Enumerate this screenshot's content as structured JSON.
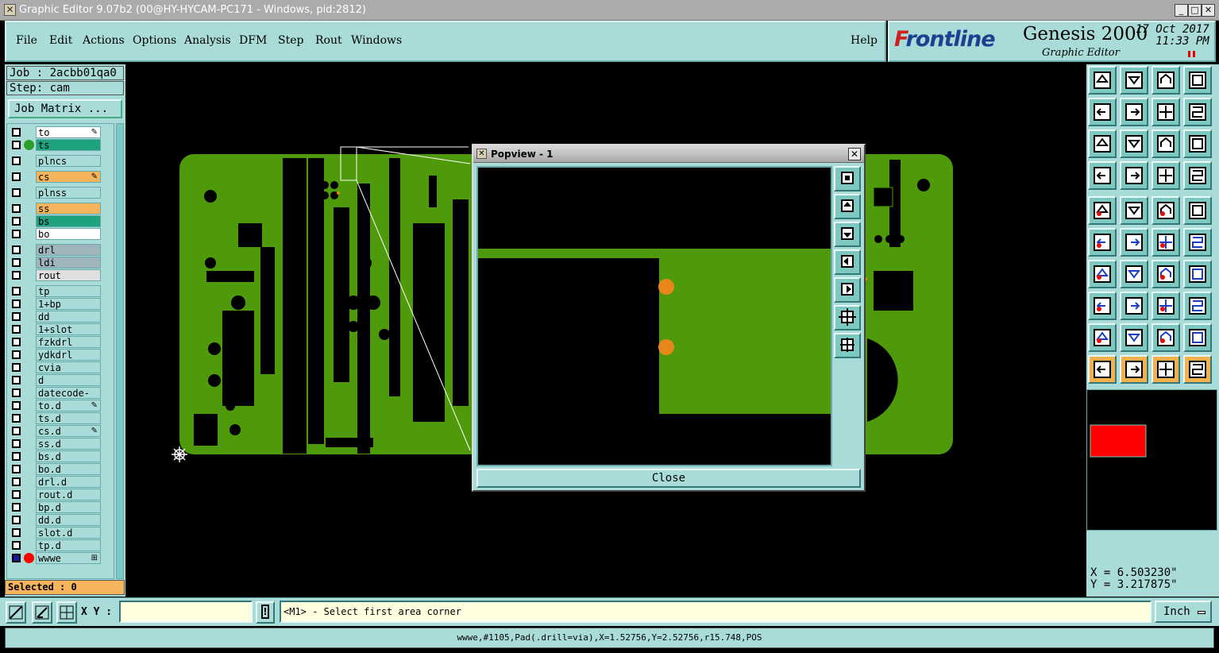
{
  "window": {
    "title": "Graphic Editor 9.07b2 (00@HY-HYCAM-PC171 - Windows, pid:2812)"
  },
  "menu": {
    "items": [
      "File",
      "Edit",
      "Actions",
      "Options",
      "Analysis",
      "DFM",
      "Step",
      "Rout",
      "Windows"
    ],
    "help": "Help"
  },
  "brand": {
    "logo_f": "F",
    "logo_rest": "rontline",
    "product": "Genesis 2000",
    "subtitle": "Graphic Editor",
    "date": "17 Oct 2017",
    "time": "11:33 PM"
  },
  "job": {
    "job_label": "Job : 2acbb01qa0",
    "step_label": "Step: cam",
    "matrix_button": "Job Matrix ..."
  },
  "layers": [
    {
      "name": "to",
      "color": "#ffffff",
      "dot": "",
      "edit": "✎"
    },
    {
      "name": "ts",
      "color": "#1fa37e",
      "dot": "#2aa02a",
      "edit": ""
    },
    {
      "name": "plncs",
      "color": "#a9dcd8",
      "dot": "",
      "edit": ""
    },
    {
      "name": "cs",
      "color": "#f6b55c",
      "dot": "",
      "edit": "✎"
    },
    {
      "name": "plnss",
      "color": "#a9dcd8",
      "dot": "",
      "edit": ""
    },
    {
      "name": "ss",
      "color": "#f6b55c",
      "dot": "",
      "edit": ""
    },
    {
      "name": "bs",
      "color": "#1fa37e",
      "dot": "",
      "edit": ""
    },
    {
      "name": "bo",
      "color": "#ffffff",
      "dot": "",
      "edit": ""
    },
    {
      "name": "drl",
      "color": "#a0b4bc",
      "dot": "",
      "edit": ""
    },
    {
      "name": "ldi",
      "color": "#a0b4bc",
      "dot": "",
      "edit": ""
    },
    {
      "name": "rout",
      "color": "#e0e0e0",
      "dot": "",
      "edit": ""
    },
    {
      "name": "tp",
      "color": "#a9dcd8",
      "dot": "",
      "edit": ""
    },
    {
      "name": "1+bp",
      "color": "#a9dcd8",
      "dot": "",
      "edit": ""
    },
    {
      "name": "dd",
      "color": "#a9dcd8",
      "dot": "",
      "edit": ""
    },
    {
      "name": "1+slot",
      "color": "#a9dcd8",
      "dot": "",
      "edit": ""
    },
    {
      "name": "fzkdrl",
      "color": "#a9dcd8",
      "dot": "",
      "edit": ""
    },
    {
      "name": "ydkdrl",
      "color": "#a9dcd8",
      "dot": "",
      "edit": ""
    },
    {
      "name": "cvia",
      "color": "#a9dcd8",
      "dot": "",
      "edit": ""
    },
    {
      "name": "d",
      "color": "#a9dcd8",
      "dot": "",
      "edit": ""
    },
    {
      "name": "datecode-bo",
      "color": "#a9dcd8",
      "dot": "",
      "edit": ""
    },
    {
      "name": "to.d",
      "color": "#a9dcd8",
      "dot": "",
      "edit": "✎"
    },
    {
      "name": "ts.d",
      "color": "#a9dcd8",
      "dot": "",
      "edit": ""
    },
    {
      "name": "cs.d",
      "color": "#a9dcd8",
      "dot": "",
      "edit": "✎"
    },
    {
      "name": "ss.d",
      "color": "#a9dcd8",
      "dot": "",
      "edit": ""
    },
    {
      "name": "bs.d",
      "color": "#a9dcd8",
      "dot": "",
      "edit": ""
    },
    {
      "name": "bo.d",
      "color": "#a9dcd8",
      "dot": "",
      "edit": ""
    },
    {
      "name": "drl.d",
      "color": "#a9dcd8",
      "dot": "",
      "edit": ""
    },
    {
      "name": "rout.d",
      "color": "#a9dcd8",
      "dot": "",
      "edit": ""
    },
    {
      "name": "bp.d",
      "color": "#a9dcd8",
      "dot": "",
      "edit": ""
    },
    {
      "name": "dd.d",
      "color": "#a9dcd8",
      "dot": "",
      "edit": ""
    },
    {
      "name": "slot.d",
      "color": "#a9dcd8",
      "dot": "",
      "edit": ""
    },
    {
      "name": "tp.d",
      "color": "#a9dcd8",
      "dot": "",
      "edit": ""
    },
    {
      "name": "wwwe",
      "color": "#a9dcd8",
      "dot": "#ff0000",
      "edit": "⊞",
      "active": true
    }
  ],
  "selected": "Selected : 0",
  "popview": {
    "title": "Popview - 1",
    "close_label": "Close"
  },
  "coords": {
    "x": "X = 6.503230\"",
    "y": "Y = 3.217875\""
  },
  "bottom": {
    "xy_label": "X Y :",
    "xy_value": "",
    "prompt": "<M1> - Select first area corner",
    "unit": "Inch"
  },
  "status": "wwwe,#1105,Pad(.drill=via),X=1.52756,Y=2.52756,r15.748,POS",
  "colors": {
    "copper": "#4f9a0a",
    "highlight": "#e8861a",
    "panel": "#a9dcd8",
    "accent_orange": "#f4b24e"
  }
}
